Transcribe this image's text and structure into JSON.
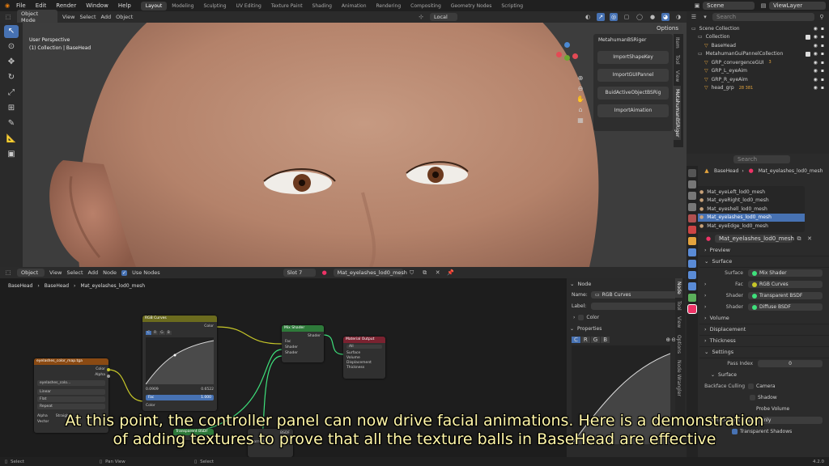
{
  "menubar": {
    "items": [
      "File",
      "Edit",
      "Render",
      "Window",
      "Help"
    ],
    "workspaces": [
      "Layout",
      "Modeling",
      "Sculpting",
      "UV Editing",
      "Texture Paint",
      "Shading",
      "Animation",
      "Rendering",
      "Compositing",
      "Geometry Nodes",
      "Scripting"
    ],
    "scene": "Scene",
    "view_layer": "ViewLayer"
  },
  "viewport": {
    "mode": "Object Mode",
    "menus": [
      "View",
      "Select",
      "Add",
      "Object"
    ],
    "orientation": "Local",
    "options": "Options",
    "info_line1": "User Perspective",
    "info_line2": "(1) Collection | BaseHead",
    "panel_title": "MetahumanBSRiger",
    "panel_buttons": [
      "ImportShapeKey",
      "ImportGUIPannel",
      "BuidActiveObjectBSRig",
      "ImportAimation"
    ],
    "side_tabs": [
      "Item",
      "Tool",
      "View",
      "MetahumanBSRiger"
    ]
  },
  "outliner": {
    "search_placeholder": "Search",
    "rows": [
      {
        "label": "Scene Collection",
        "indent": 0,
        "badge": ""
      },
      {
        "label": "Collection",
        "indent": 1,
        "badge": ""
      },
      {
        "label": "BaseHead",
        "indent": 2,
        "badge": ""
      },
      {
        "label": "MetahumanGuiPannelCollection",
        "indent": 1,
        "badge": ""
      },
      {
        "label": "GRP_convergenceGUI",
        "indent": 2,
        "badge": "3"
      },
      {
        "label": "GRP_L_eyeAim",
        "indent": 2,
        "badge": ""
      },
      {
        "label": "GRP_R_eyeAim",
        "indent": 2,
        "badge": ""
      },
      {
        "label": "head_grp",
        "indent": 2,
        "badge": "28 381"
      }
    ]
  },
  "properties": {
    "search_placeholder": "Search",
    "breadcrumb": [
      "BaseHead",
      "Mat_eyelashes_lod0_mesh"
    ],
    "slots": [
      "Mat_eyeLeft_lod0_mesh",
      "Mat_eyeRight_lod0_mesh",
      "Mat_eyeshell_lod0_mesh",
      "Mat_eyelashes_lod0_mesh",
      "Mat_eyeEdge_lod0_mesh"
    ],
    "selected_slot": "Mat_eyelashes_lod0_mesh",
    "material_name": "Mat_eyelashes_lod0_mesh",
    "sections": {
      "preview": "Preview",
      "surface": "Surface",
      "volume": "Volume",
      "displacement": "Displacement",
      "thickness": "Thickness",
      "settings": "Settings"
    },
    "surface_rows": [
      {
        "label": "Surface",
        "value": "Mix Shader"
      },
      {
        "label": "Fac",
        "value": "RGB Curves"
      },
      {
        "label": "Shader",
        "value": "Transparent BSDF"
      },
      {
        "label": "Shader",
        "value": "Diffuse BSDF"
      }
    ],
    "pass_index_label": "Pass Index",
    "pass_index": "0",
    "sub_surface": "Surface",
    "backface_label": "Backface Culling",
    "backface_value": "Camera",
    "shadow_label": "Shadow",
    "probe_volume": "Probe Volume",
    "displacement_label": "Displacement",
    "only_label": "Only",
    "transparent_shadows": "Transparent Shadows"
  },
  "node_editor": {
    "type": "Object",
    "menus": [
      "View",
      "Select",
      "Add",
      "Node"
    ],
    "use_nodes": "Use Nodes",
    "slot": "Slot 7",
    "material": "Mat_eyelashes_lod0_mesh",
    "breadcrumb": [
      "BaseHead",
      "BaseHead",
      "Mat_eyelashes_lod0_mesh"
    ],
    "nodes": {
      "image": {
        "title": "eyelashes_color_map.tga",
        "outputs": [
          "Color",
          "Alpha"
        ],
        "fields": [
          "eyelashes_colo...",
          "Linear",
          "Flat",
          "Repeat"
        ],
        "extra": [
          "Alpha",
          "Straight"
        ],
        "input": "Vector"
      },
      "curves": {
        "title": "RGB Curves",
        "output": "Color",
        "tabs": [
          "C",
          "R",
          "G",
          "B"
        ],
        "black": "0.0909",
        "white": "0.6522",
        "fac_label": "Fac",
        "fac_value": "1.000",
        "input": "Color"
      },
      "mix": {
        "title": "Mix Shader",
        "output": "Shader",
        "inputs": [
          "Fac",
          "Shader",
          "Shader"
        ]
      },
      "output": {
        "title": "Material Output",
        "target": "All",
        "inputs": [
          "Surface",
          "Volume",
          "Displacement",
          "Thickness"
        ]
      },
      "transparent": {
        "title": "Transparent BSDF"
      },
      "bottom": {
        "labels": [
          "BSDF",
          "Normal"
        ]
      }
    }
  },
  "node_sidebar": {
    "header": "Node",
    "name_label": "Name:",
    "name_value": "RGB Curves",
    "label_label": "Label:",
    "color_section": "Color",
    "properties_section": "Properties",
    "tabs": [
      "C",
      "R",
      "G",
      "B"
    ],
    "side_tabs": [
      "Node",
      "Tool",
      "View",
      "Options",
      "Node Wrangler"
    ]
  },
  "subtitle": {
    "line1": "At this point, the controller panel can now drive facial animations. Here is a demonstration",
    "line2": "of adding textures to prove that all the texture balls in BaseHead are effective"
  },
  "statusbar": {
    "items": [
      "Select",
      "Pan View",
      "Select"
    ],
    "version": "4.2.0",
    "overlay_text": "LMB"
  }
}
